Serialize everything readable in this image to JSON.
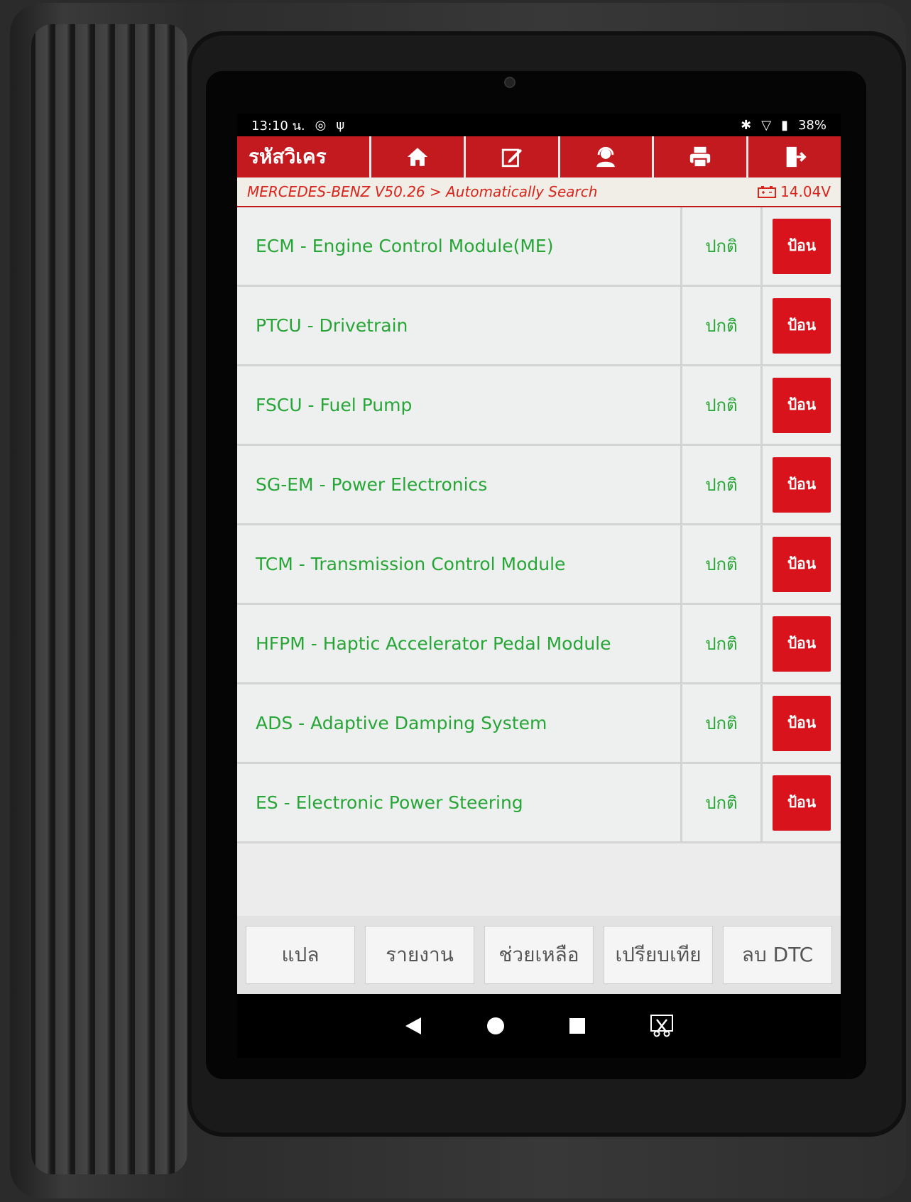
{
  "status_bar": {
    "time": "13:10 น.",
    "battery": "38%"
  },
  "toolbar": {
    "title": "รหัสวิเคร",
    "icons": [
      "home-icon",
      "edit-icon",
      "support-icon",
      "print-icon",
      "exit-icon"
    ]
  },
  "breadcrumb": {
    "path": "MERCEDES-BENZ V50.26 > Automatically Search",
    "voltage": "14.04V"
  },
  "modules": [
    {
      "name": "ECM - Engine Control Module(ME)",
      "status": "ปกติ",
      "action": "ป้อน"
    },
    {
      "name": "PTCU - Drivetrain",
      "status": "ปกติ",
      "action": "ป้อน"
    },
    {
      "name": "FSCU - Fuel Pump",
      "status": "ปกติ",
      "action": "ป้อน"
    },
    {
      "name": "SG-EM - Power Electronics",
      "status": "ปกติ",
      "action": "ป้อน"
    },
    {
      "name": "TCM - Transmission Control Module",
      "status": "ปกติ",
      "action": "ป้อน"
    },
    {
      "name": "HFPM - Haptic Accelerator Pedal Module",
      "status": "ปกติ",
      "action": "ป้อน"
    },
    {
      "name": "ADS - Adaptive Damping System",
      "status": "ปกติ",
      "action": "ป้อน"
    },
    {
      "name": "ES - Electronic Power Steering",
      "status": "ปกติ",
      "action": "ป้อน"
    }
  ],
  "footer": {
    "translate": "แปล",
    "report": "รายงาน",
    "help": "ช่วยเหลือ",
    "compare": "เปรียบเทีย",
    "clear_dtc": "ลบ DTC"
  },
  "colors": {
    "accent_red": "#c21a1f",
    "status_green": "#27a637"
  }
}
